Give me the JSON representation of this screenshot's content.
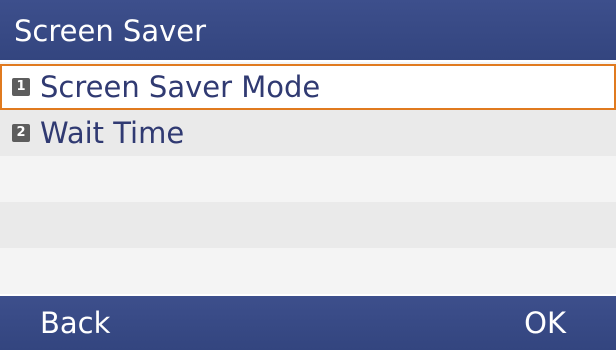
{
  "title": "Screen Saver",
  "menu": {
    "items": [
      {
        "number": "1",
        "label": "Screen Saver Mode",
        "selected": true
      },
      {
        "number": "2",
        "label": "Wait Time",
        "selected": false
      },
      {
        "number": "",
        "label": "",
        "selected": false
      },
      {
        "number": "",
        "label": "",
        "selected": false
      },
      {
        "number": "",
        "label": "",
        "selected": false
      }
    ]
  },
  "softkeys": {
    "left": "Back",
    "right": "OK"
  },
  "colors": {
    "bar": "#3d4f8c",
    "selection_border": "#e07a1f",
    "item_text": "#303a72"
  }
}
